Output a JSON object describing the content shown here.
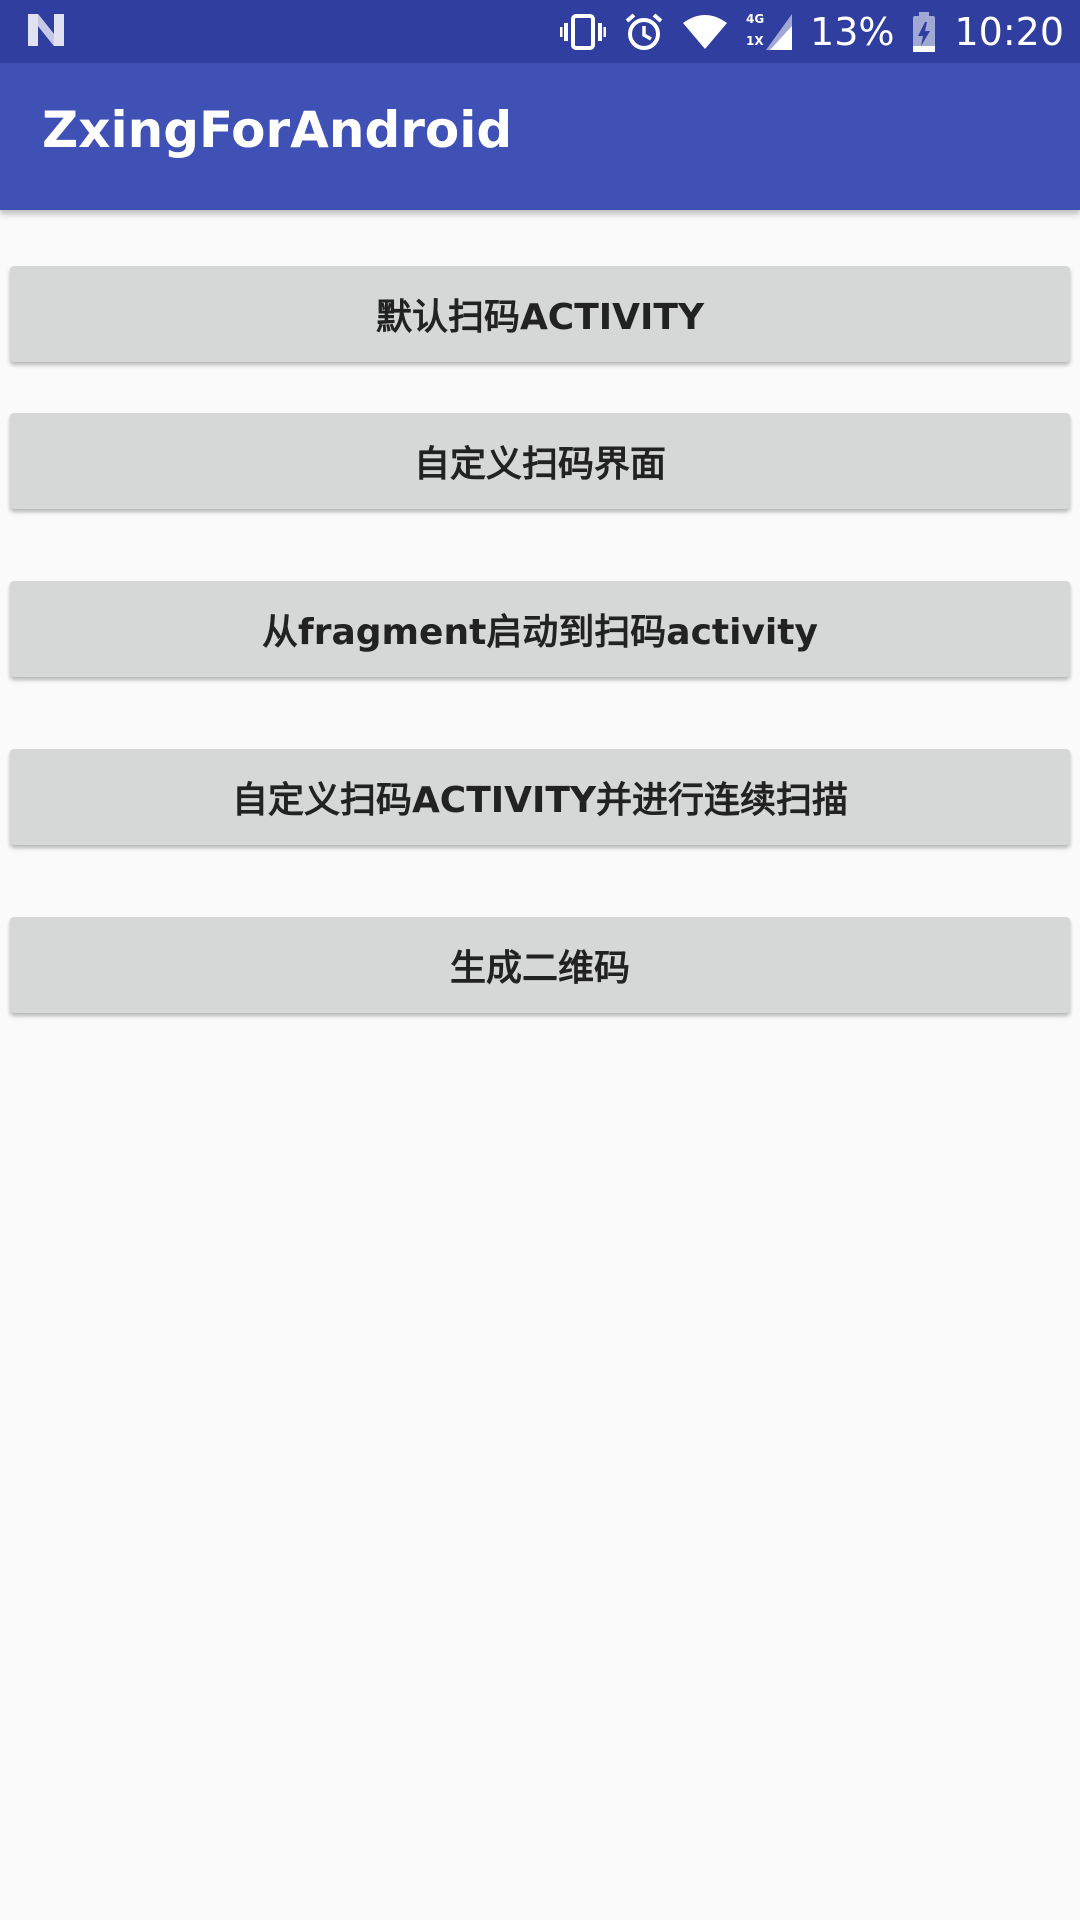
{
  "status_bar": {
    "left_icon": "n-logo-icon",
    "icons": [
      "vibrate-icon",
      "alarm-icon",
      "wifi-icon",
      "signal-4g-icon",
      "battery-charging-icon"
    ],
    "network_label_top": "4G",
    "network_label_bottom": "1X",
    "battery_percent": "13%",
    "time": "10:20"
  },
  "app_bar": {
    "title": "ZxingForAndroid",
    "color": "#3f51b5"
  },
  "buttons": [
    {
      "label": "默认扫码ACTIVITY"
    },
    {
      "label": "自定义扫码界面"
    },
    {
      "label": "从fragment启动到扫码activity"
    },
    {
      "label": "自定义扫码ACTIVITY并进行连续扫描"
    },
    {
      "label": "生成二维码"
    }
  ],
  "colors": {
    "status_bar": "#303f9f",
    "background": "#fafafa",
    "button": "#d6d7d7",
    "button_text": "#222222"
  }
}
